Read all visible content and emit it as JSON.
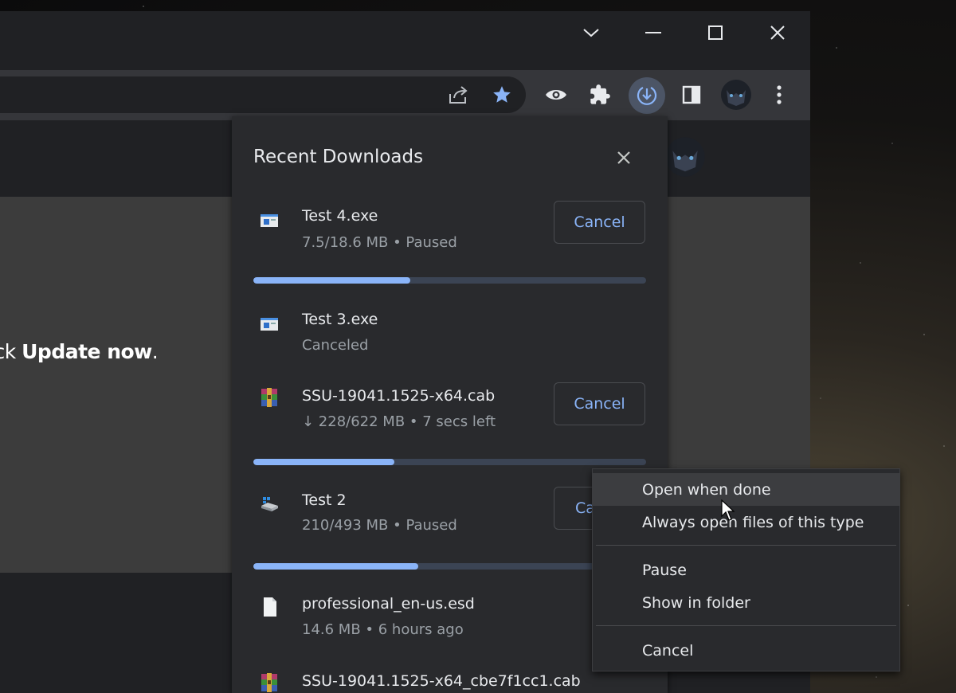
{
  "page": {
    "text_prefix": "ick",
    "text_bold": "Update now",
    "text_suffix": "."
  },
  "downloads_panel": {
    "title": "Recent Downloads",
    "items": [
      {
        "name": "Test 4.exe",
        "status": "7.5/18.6 MB • Paused",
        "button": "Cancel",
        "progress": 0.4,
        "icon": "exe-file-icon"
      },
      {
        "name": "Test 3.exe",
        "status": "Canceled",
        "icon": "exe-file-icon"
      },
      {
        "name": "SSU-19041.1525-x64.cab",
        "status": "↓ 228/622 MB • 7 secs left",
        "button": "Cancel",
        "progress": 0.36,
        "icon": "winrar-archive-icon"
      },
      {
        "name": "Test 2",
        "status": "210/493 MB • Paused",
        "button": "Ca",
        "progress": 0.42,
        "icon": "drive-file-icon"
      },
      {
        "name": "professional_en-us.esd",
        "status": "14.6 MB • 6 hours ago",
        "icon": "blank-file-icon"
      },
      {
        "name": "SSU-19041.1525-x64_cbe7f1cc1.cab",
        "icon": "winrar-archive-icon"
      }
    ]
  },
  "context_menu": {
    "items": [
      {
        "label": "Open when done",
        "highlighted": true
      },
      {
        "label": "Always open files of this type"
      },
      {
        "label": "Pause"
      },
      {
        "label": "Show in folder"
      },
      {
        "label": "Cancel"
      }
    ]
  },
  "colors": {
    "accent": "#8ab4f8",
    "panel_bg": "#292a2d",
    "toolbar_bg": "#35363a"
  }
}
